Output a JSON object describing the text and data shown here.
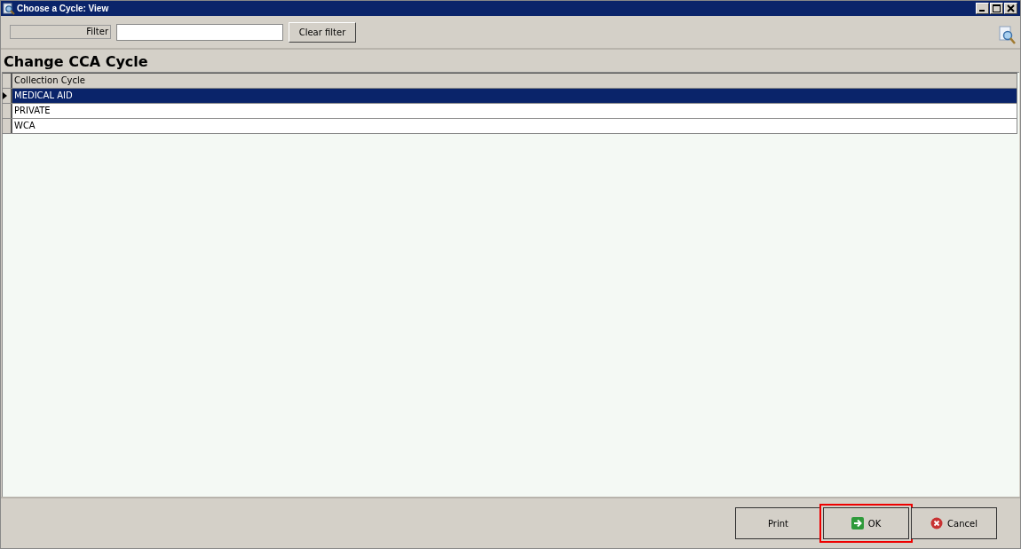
{
  "window": {
    "title": "Choose a Cycle: View"
  },
  "toolbar": {
    "filter_label": "Filter",
    "clear_button": "Clear filter"
  },
  "heading": "Change CCA Cycle",
  "table": {
    "columns": [
      "Collection Cycle"
    ],
    "rows": [
      {
        "cells": [
          "MEDICAL AID"
        ],
        "selected": true
      },
      {
        "cells": [
          "PRIVATE"
        ],
        "selected": false
      },
      {
        "cells": [
          "WCA"
        ],
        "selected": false
      }
    ]
  },
  "buttons": [
    {
      "label": "Print",
      "kind": "plain",
      "highlighted": false
    },
    {
      "label": "OK",
      "kind": "ok",
      "highlighted": true
    },
    {
      "label": "Cancel",
      "kind": "cancel",
      "highlighted": false
    }
  ]
}
